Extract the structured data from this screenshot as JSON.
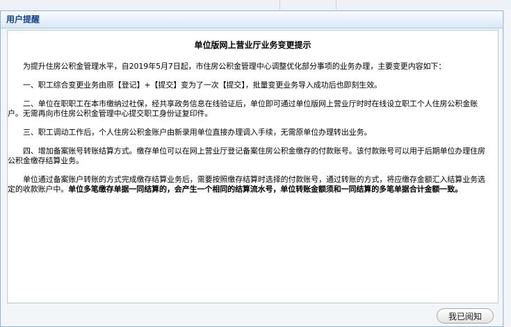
{
  "dialog": {
    "title": "用户提醒",
    "ack_button": "我已阅知"
  },
  "notice": {
    "heading": "单位版网上营业厅业务变更提示",
    "paragraphs": [
      "为提升住房公积金管理水平，自2019年5月7日起，市住房公积金管理中心调整优化部分事项的业务办理，主要变更内容如下：",
      "一、职工综合变更业务由原【登记】+【提交】变为了一次【提交】，批量变更业务导入成功后也即刻生效。",
      "二、单位在职职工在本市缴纳过社保，经共享政务信息在线验证后，单位即可通过单位版网上营业厅时时在线设立职工个人住房公积金账户。无需再向市住房公积金管理中心提交职工身份证复印件。",
      "三、职工调动工作后，个人住房公积金账户由新录用单位直接办理调入手续，无需原单位办理转出业务。",
      "四、增加备案账号转账结算方式。缴存单位可以在网上营业厅登记备案住房公积金缴存的付款账号。该付款账号可以用于后期单位办理住房公积金缴存结算业务。"
    ],
    "last_paragraph_normal": "单位通过备案账户转账的方式完成缴存结算业务后，需要按照缴存结算时选择的付款账号，通过转账的方式，将应缴存金额汇入结算业务选定的收款账户中。",
    "last_paragraph_bold": "单位多笔缴存单据一同结算的，会产生一个相同的结算流水号，单位转账金额须和一同结算的多笔单据合计金额一致。"
  }
}
